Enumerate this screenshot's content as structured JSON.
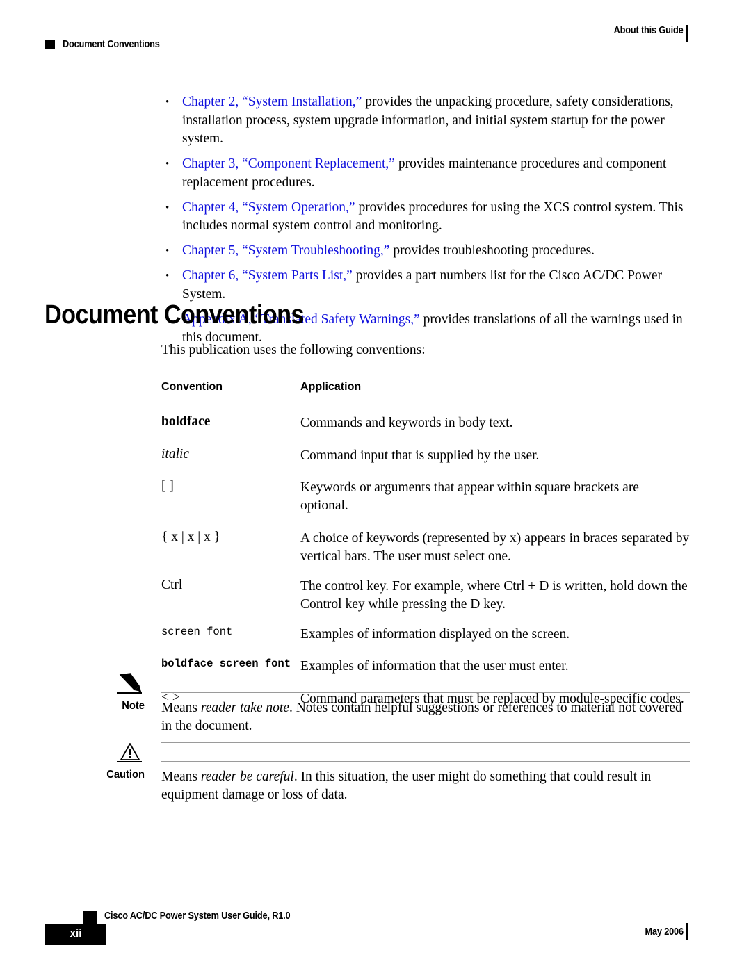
{
  "header": {
    "running_head_right": "About this Guide",
    "running_head_left": "Document Conventions"
  },
  "bullets": [
    {
      "link": "Chapter 2, “System Installation,”",
      "text": " provides the unpacking procedure, safety considerations, installation process, system upgrade information, and initial system startup for the power system."
    },
    {
      "link": "Chapter 3, “Component Replacement,”",
      "text": " provides maintenance procedures and component replacement procedures."
    },
    {
      "link": "Chapter 4, “System Operation,”",
      "text": " provides procedures for using the XCS control system. This includes normal system control and monitoring."
    },
    {
      "link": "Chapter 5, “System Troubleshooting,”",
      "text": " provides troubleshooting procedures."
    },
    {
      "link": "Chapter 6, “System Parts List,”",
      "text": " provides a part numbers list for the Cisco AC/DC Power System."
    },
    {
      "link": "Appendix A, “Translated Safety Warnings,”",
      "text": " provides translations of all the warnings used in this document."
    }
  ],
  "section": {
    "heading": "Document Conventions",
    "intro": "This publication uses the following conventions:"
  },
  "table": {
    "headers": {
      "convention": "Convention",
      "application": "Application"
    },
    "rows": [
      {
        "convention": "boldface",
        "application": "Commands and keywords in body text."
      },
      {
        "convention": "italic",
        "application": "Command input that is supplied by the user."
      },
      {
        "convention": "[   ]",
        "application": "Keywords or arguments that appear within square brackets are optional."
      },
      {
        "convention": "{ x | x | x }",
        "application": "A choice of keywords (represented by x) appears in braces separated by vertical bars. The user must select one."
      },
      {
        "convention": "Ctrl",
        "application": "The control key. For example, where Ctrl + D is written, hold down the Control key while pressing the D key."
      },
      {
        "convention": "screen font",
        "application": "Examples of information displayed on the screen."
      },
      {
        "convention": "boldface screen font",
        "application": "Examples of information that the user must enter."
      },
      {
        "convention": "<   >",
        "application": "Command parameters that must be replaced by module-specific codes."
      }
    ]
  },
  "admonitions": {
    "note": {
      "label": "Note",
      "icon": "pencil-icon",
      "lead": "Means ",
      "emphasis": "reader take note",
      "rest": ". Notes contain helpful suggestions or references to material not covered in the document."
    },
    "caution": {
      "label": "Caution",
      "icon": "warning-triangle-icon",
      "lead": "Means ",
      "emphasis": "reader be careful",
      "rest": ". In this situation, the user might do something that could result in equipment damage or loss of data."
    }
  },
  "footer": {
    "page_number": "xii",
    "guide_title": "Cisco AC/DC Power System User Guide, R1.0",
    "date": "May 2006"
  },
  "colors": {
    "link": "#1111dd",
    "rule": "#6b6b6b",
    "admon_rule": "#9a9a9a"
  }
}
